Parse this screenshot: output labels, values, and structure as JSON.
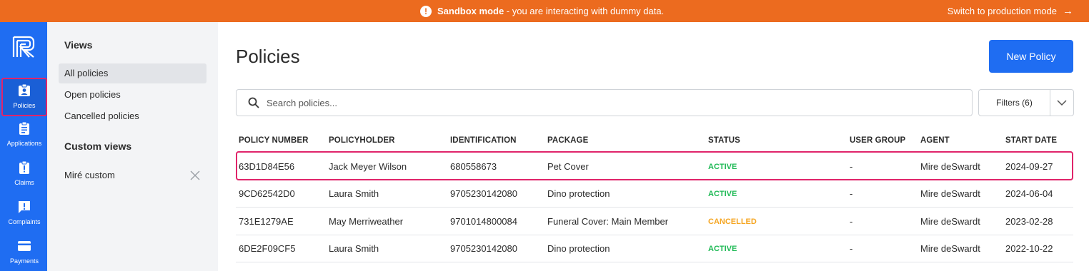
{
  "banner": {
    "bold": "Sandbox mode",
    "text": " - you are interacting with dummy data.",
    "link": "Switch to production mode",
    "icon": "alert-circle-icon",
    "color": "#ec6b1f"
  },
  "nav": {
    "color": "#1f6df2",
    "items": [
      {
        "label": "Policies",
        "icon": "badge-icon"
      },
      {
        "label": "Applications",
        "icon": "clipboard-icon"
      },
      {
        "label": "Claims",
        "icon": "clipboard-alert-icon"
      },
      {
        "label": "Complaints",
        "icon": "chat-alert-icon"
      },
      {
        "label": "Payments",
        "icon": "credit-card-icon"
      }
    ]
  },
  "views": {
    "heading": "Views",
    "items": [
      "All policies",
      "Open policies",
      "Cancelled policies"
    ],
    "custom_heading": "Custom views",
    "custom_items": [
      "Miré custom"
    ]
  },
  "main": {
    "title": "Policies",
    "new_button": "New Policy",
    "search_placeholder": "Search policies...",
    "filters": "Filters (6)"
  },
  "table": {
    "headers": [
      "POLICY NUMBER",
      "POLICYHOLDER",
      "IDENTIFICATION",
      "PACKAGE",
      "STATUS",
      "USER GROUP",
      "AGENT",
      "START DATE"
    ],
    "rows": [
      {
        "number": "63D1D84E56",
        "holder": "Jack Meyer Wilson",
        "id": "680558673",
        "package": "Pet Cover",
        "status": "ACTIVE",
        "group": "-",
        "agent": "Mire deSwardt",
        "start": "2024-09-27"
      },
      {
        "number": "9CD62542D0",
        "holder": "Laura Smith",
        "id": "9705230142080",
        "package": "Dino protection",
        "status": "ACTIVE",
        "group": "-",
        "agent": "Mire deSwardt",
        "start": "2024-06-04"
      },
      {
        "number": "731E1279AE",
        "holder": "May Merriweather",
        "id": "9701014800084",
        "package": "Funeral Cover: Main Member",
        "status": "CANCELLED",
        "group": "-",
        "agent": "Mire deSwardt",
        "start": "2023-02-28"
      },
      {
        "number": "6DE2F09CF5",
        "holder": "Laura Smith",
        "id": "9705230142080",
        "package": "Dino protection",
        "status": "ACTIVE",
        "group": "-",
        "agent": "Mire deSwardt",
        "start": "2022-10-22"
      }
    ],
    "status_colors": {
      "ACTIVE": "#1db954",
      "CANCELLED": "#f5a623"
    }
  }
}
